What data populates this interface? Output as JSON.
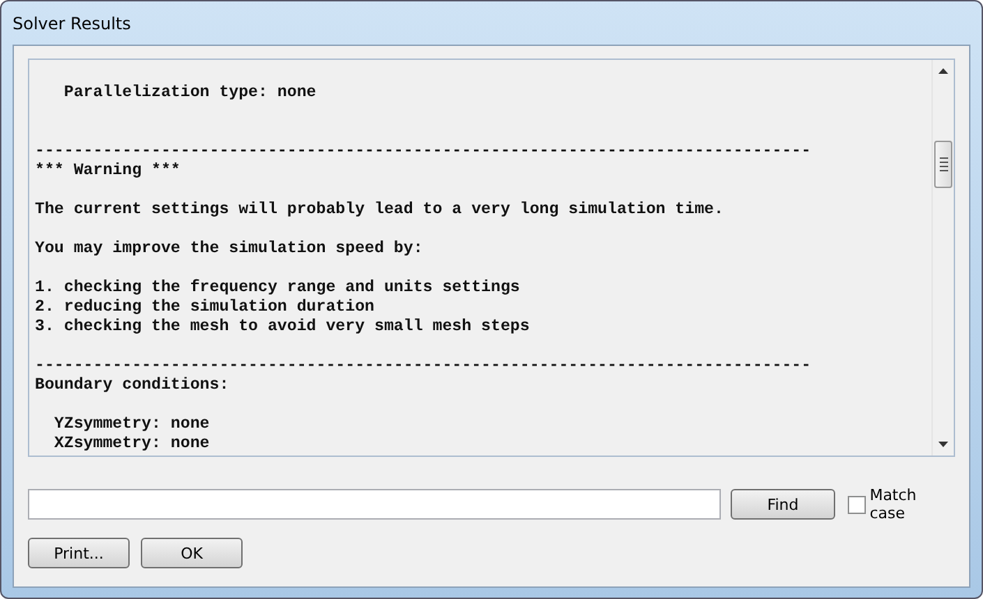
{
  "window": {
    "title": "Solver Results"
  },
  "log": {
    "text": "\n   Parallelization type: none\n\n\n--------------------------------------------------------------------------------\n*** Warning ***\n\nThe current settings will probably lead to a very long simulation time.\n\nYou may improve the simulation speed by:\n\n1. checking the frequency range and units settings\n2. reducing the simulation duration\n3. checking the mesh to avoid very small mesh steps\n\n--------------------------------------------------------------------------------\nBoundary conditions:\n\n  YZsymmetry: none\n  XZsymmetry: none"
  },
  "find": {
    "button": "Find",
    "match_case": {
      "label": "Match case",
      "checked": false
    }
  },
  "buttons": [
    "Print...",
    "OK"
  ]
}
